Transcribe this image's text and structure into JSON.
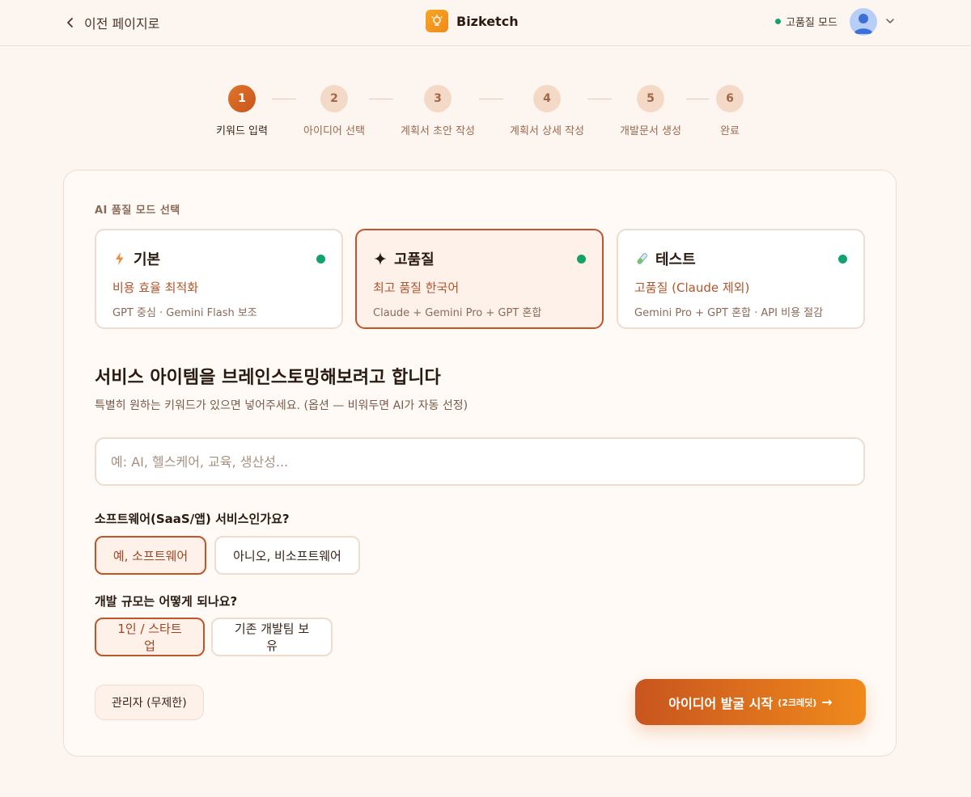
{
  "header": {
    "back_label": "이전 페이지로",
    "brand_name": "Bizketch",
    "mode_status": "고품질 모드"
  },
  "steps": [
    {
      "num": "1",
      "label": "키워드 입력"
    },
    {
      "num": "2",
      "label": "아이디어 선택"
    },
    {
      "num": "3",
      "label": "계획서 초안 작성"
    },
    {
      "num": "4",
      "label": "계획서 상세 작성"
    },
    {
      "num": "5",
      "label": "개발문서 생성"
    },
    {
      "num": "6",
      "label": "완료"
    }
  ],
  "quality": {
    "section_label": "AI 품질 모드 선택",
    "modes": [
      {
        "title": "기본",
        "subtitle": "비용 효율 최적화",
        "desc": "GPT 중심 · Gemini Flash 보조"
      },
      {
        "title": "고품질",
        "subtitle": "최고 품질 한국어",
        "desc": "Claude + Gemini Pro + GPT 혼합"
      },
      {
        "title": "테스트",
        "subtitle": "고품질 (Claude 제외)",
        "desc": "Gemini Pro + GPT 혼합 · API 비용 절감"
      }
    ]
  },
  "brainstorm": {
    "heading": "서비스 아이템을 브레인스토밍해보려고 합니다",
    "subheading": "특별히 원하는 키워드가 있으면 넣어주세요. (옵션 — 비워두면 AI가 자동 선정)",
    "input_placeholder": "예: AI, 헬스케어, 교육, 생산성...",
    "input_value": ""
  },
  "software_question": {
    "label": "소프트웨어(SaaS/앱) 서비스인가요?",
    "options": [
      "예, 소프트웨어",
      "아니오, 비소프트웨어"
    ]
  },
  "scale_question": {
    "label": "개발 규모는 어떻게 되나요?",
    "options": [
      "1인 / 스타트업",
      "기존 개발팀 보유"
    ]
  },
  "actions": {
    "admin_label": "관리자 (무제한)",
    "cta_label": "아이디어 발굴 시작",
    "cta_credit": "(2크레딧)",
    "cta_arrow": "→"
  },
  "colors": {
    "accent": "#c8551f",
    "accent_light": "#f08a1c",
    "status_green": "#11a36b",
    "background": "#fdf6f0"
  }
}
